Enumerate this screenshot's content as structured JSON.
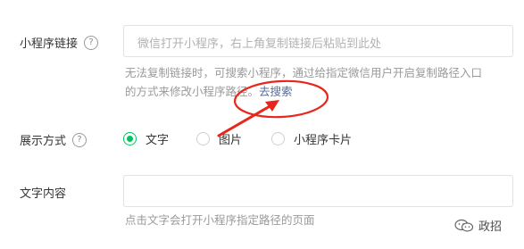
{
  "miniprogram_link": {
    "label": "小程序链接",
    "help": "?",
    "placeholder": "微信打开小程序，右上角复制链接后粘贴到此处",
    "hint_line1": "无法复制链接时，可搜索小程序，通过给指定微信用户开启复制路径入口",
    "hint_line2_prefix": "的方式来修改小程序路径。",
    "search_link": "去搜索"
  },
  "display_mode": {
    "label": "展示方式",
    "help": "?",
    "options": [
      "文字",
      "图片",
      "小程序卡片"
    ],
    "selected": "文字"
  },
  "text_content": {
    "label": "文字内容",
    "value": "",
    "hint": "点击文字会打开小程序指定路径的页面"
  },
  "watermark": {
    "text": "政招",
    "icon": "wechat-channel-icon"
  },
  "colors": {
    "accent": "#07c160",
    "link": "#576b95",
    "annotation": "#e8261b"
  }
}
